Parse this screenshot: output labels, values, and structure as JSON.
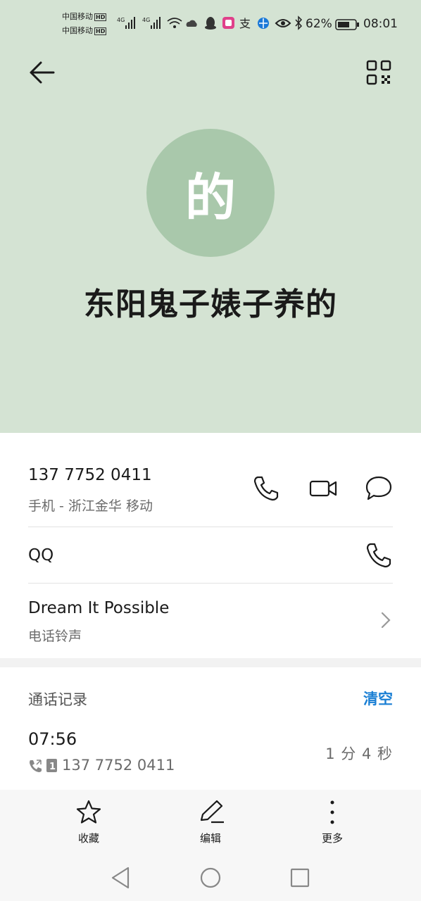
{
  "status_bar": {
    "carrier1": "中国移动",
    "carrier2": "中国移动",
    "hd": "HD",
    "net": "4G",
    "battery": "62%",
    "time": "08:01"
  },
  "contact": {
    "avatar_char": "的",
    "name": "东阳鬼子婊子养的"
  },
  "phone": {
    "number": "137 7752 0411",
    "detail": "手机 - 浙江金华 移动"
  },
  "qq": {
    "label": "QQ"
  },
  "ringtone": {
    "name": "Dream It Possible",
    "label": "电话铃声"
  },
  "call_log": {
    "title": "通话记录",
    "clear_label": "清空",
    "entries": [
      {
        "time": "07:56",
        "number": "137 7752 0411",
        "duration": "1 分 4 秒"
      }
    ]
  },
  "actions": {
    "favorite": "收藏",
    "edit": "编辑",
    "more": "更多"
  }
}
